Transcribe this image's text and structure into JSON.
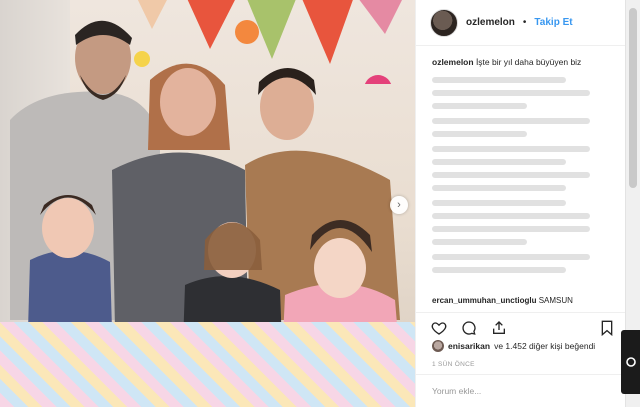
{
  "post": {
    "username": "ozlemelon",
    "separator": "•",
    "follow_label": "Takip Et",
    "caption_user": "ozlemelon",
    "caption_text": "İşte bir yıl daha büyüyen biz",
    "last_comment_user": "ercan_ummuhan_unctioglu",
    "last_comment_text": "SAMSUN",
    "likes_user": "enisarikan",
    "likes_rest": "ve 1.452 diğer kişi beğendi",
    "time": "1 SÜN ÖNCE",
    "add_comment_placeholder": "Yorum ekle..."
  },
  "icons": {
    "like": "heart-icon",
    "comment": "comment-icon",
    "share": "share-icon",
    "save": "bookmark-icon",
    "next": "chevron-right-icon"
  },
  "colors": {
    "accent": "#3897f0",
    "text": "#262626",
    "muted": "#999999"
  }
}
